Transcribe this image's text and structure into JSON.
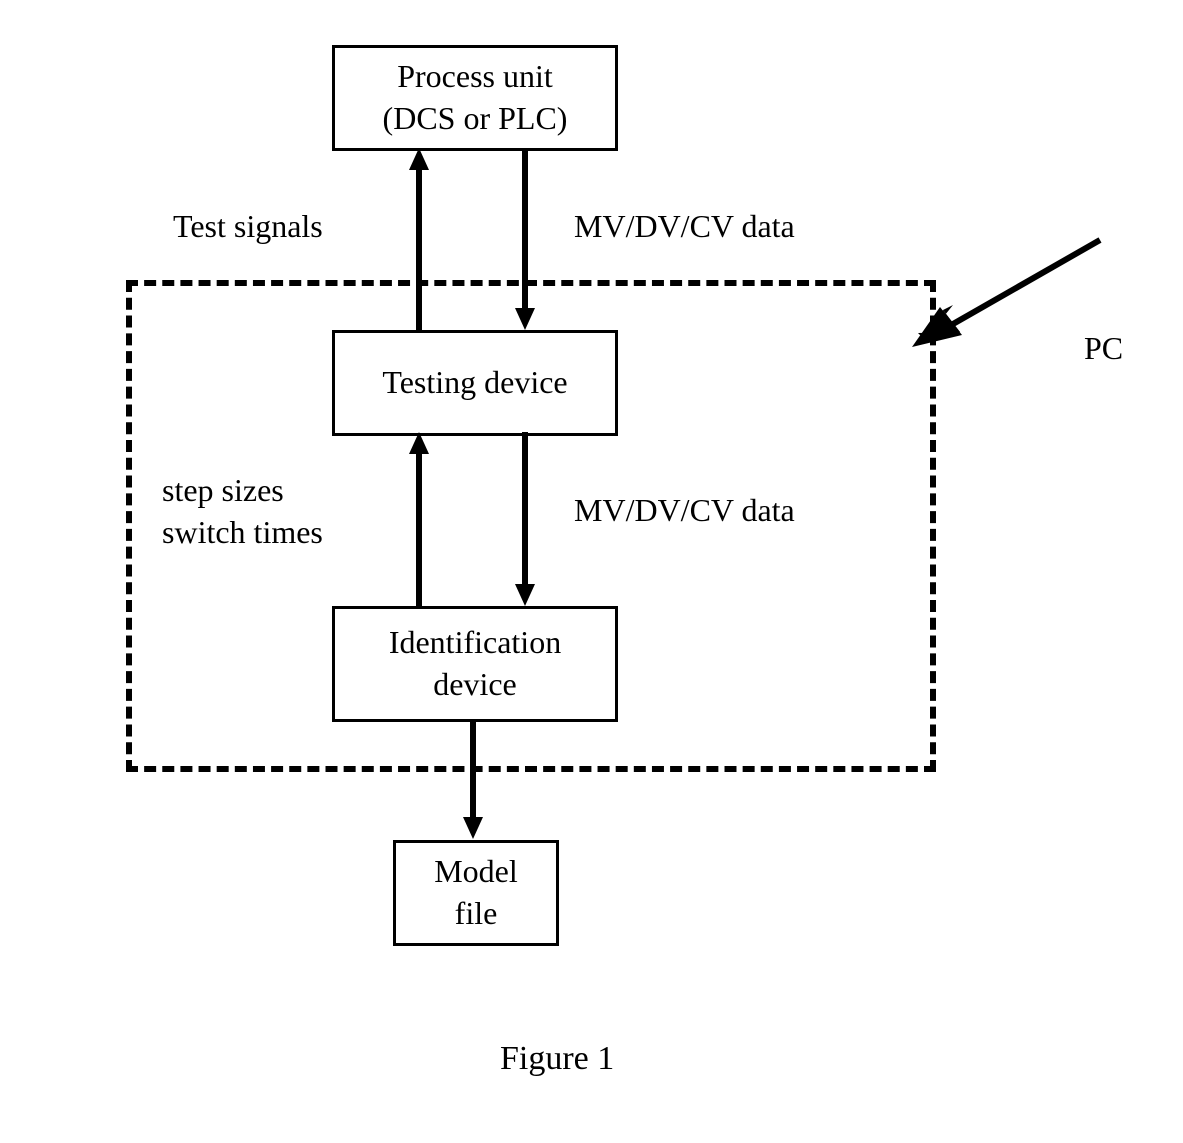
{
  "boxes": {
    "process_unit": "Process unit\n(DCS or PLC)",
    "testing_device": "Testing device",
    "identification_device": "Identification\ndevice",
    "model_file": "Model\nfile"
  },
  "labels": {
    "test_signals": "Test signals",
    "mvdvcv_top": "MV/DV/CV data",
    "step_sizes": "step sizes\nswitch times",
    "mvdvcv_mid": "MV/DV/CV data",
    "pc": "PC"
  },
  "caption": "Figure 1"
}
